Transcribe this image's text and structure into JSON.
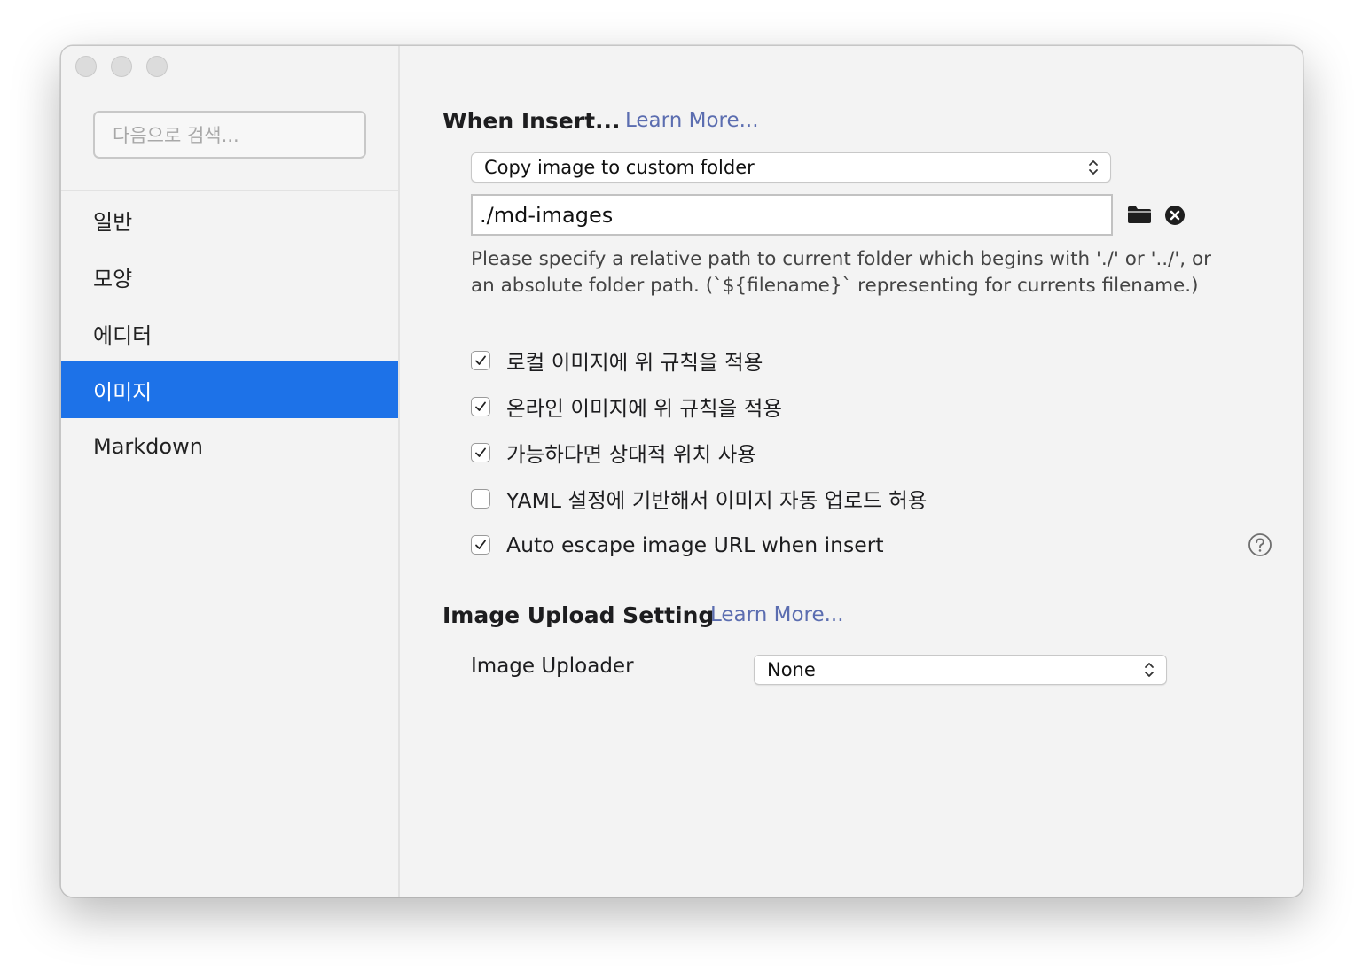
{
  "sidebar": {
    "search_placeholder": "다음으로 검색...",
    "items": [
      {
        "label": "일반",
        "active": false
      },
      {
        "label": "모양",
        "active": false
      },
      {
        "label": "에디터",
        "active": false
      },
      {
        "label": "이미지",
        "active": true
      },
      {
        "label": "Markdown",
        "active": false
      }
    ]
  },
  "when_insert": {
    "title": "When Insert...",
    "learn_more": "Learn More...",
    "action_select": "Copy image to custom folder",
    "path_value": "./md-images",
    "path_help": " Please specify a relative path to current folder which begins with './' or '../', or an absolute folder path. (`${filename}` representing for currents filename.)",
    "options": [
      {
        "label": "로컬 이미지에 위 규칙을 적용",
        "checked": true
      },
      {
        "label": "온라인 이미지에 위 규칙을 적용",
        "checked": true
      },
      {
        "label": "가능하다면 상대적 위치 사용",
        "checked": true
      },
      {
        "label": "YAML 설정에 기반해서 이미지 자동 업로드 허용",
        "checked": false
      },
      {
        "label": "Auto escape image URL when insert",
        "checked": true
      }
    ]
  },
  "upload": {
    "title": "Image Upload Setting",
    "learn_more": "Learn More...",
    "uploader_label": "Image Uploader",
    "uploader_value": "None"
  },
  "colors": {
    "accent": "#1d72e8",
    "link": "#5b6db0",
    "window_bg": "#f3f3f3"
  }
}
